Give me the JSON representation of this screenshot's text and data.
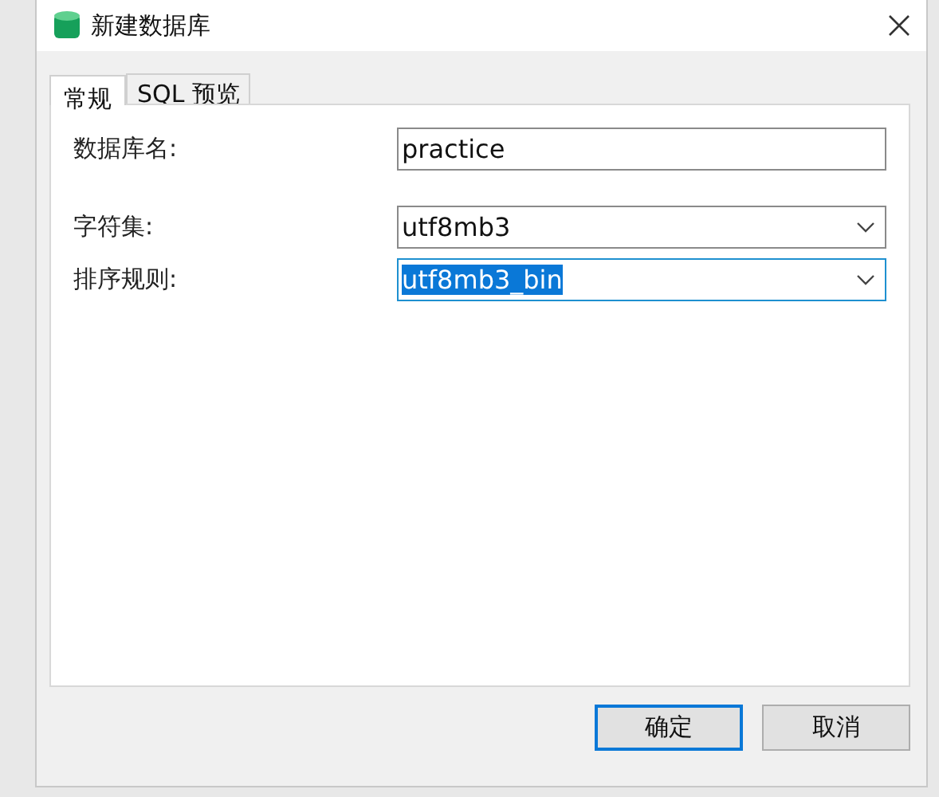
{
  "window": {
    "title": "新建数据库"
  },
  "tabs": [
    {
      "label": "常规",
      "selected": true
    },
    {
      "label": "SQL 预览",
      "selected": false
    }
  ],
  "fields": [
    {
      "kind": "text",
      "label": "数据库名:",
      "value": "practice",
      "focused": false
    },
    {
      "kind": "dropdown",
      "label": "字符集:",
      "value": "utf8mb3",
      "focused": false
    },
    {
      "kind": "dropdown",
      "label": "排序规则:",
      "value": "utf8mb3_bin",
      "focused": true
    }
  ],
  "buttons": [
    {
      "label": "确定",
      "default": true
    },
    {
      "label": "取消",
      "default": false
    }
  ]
}
